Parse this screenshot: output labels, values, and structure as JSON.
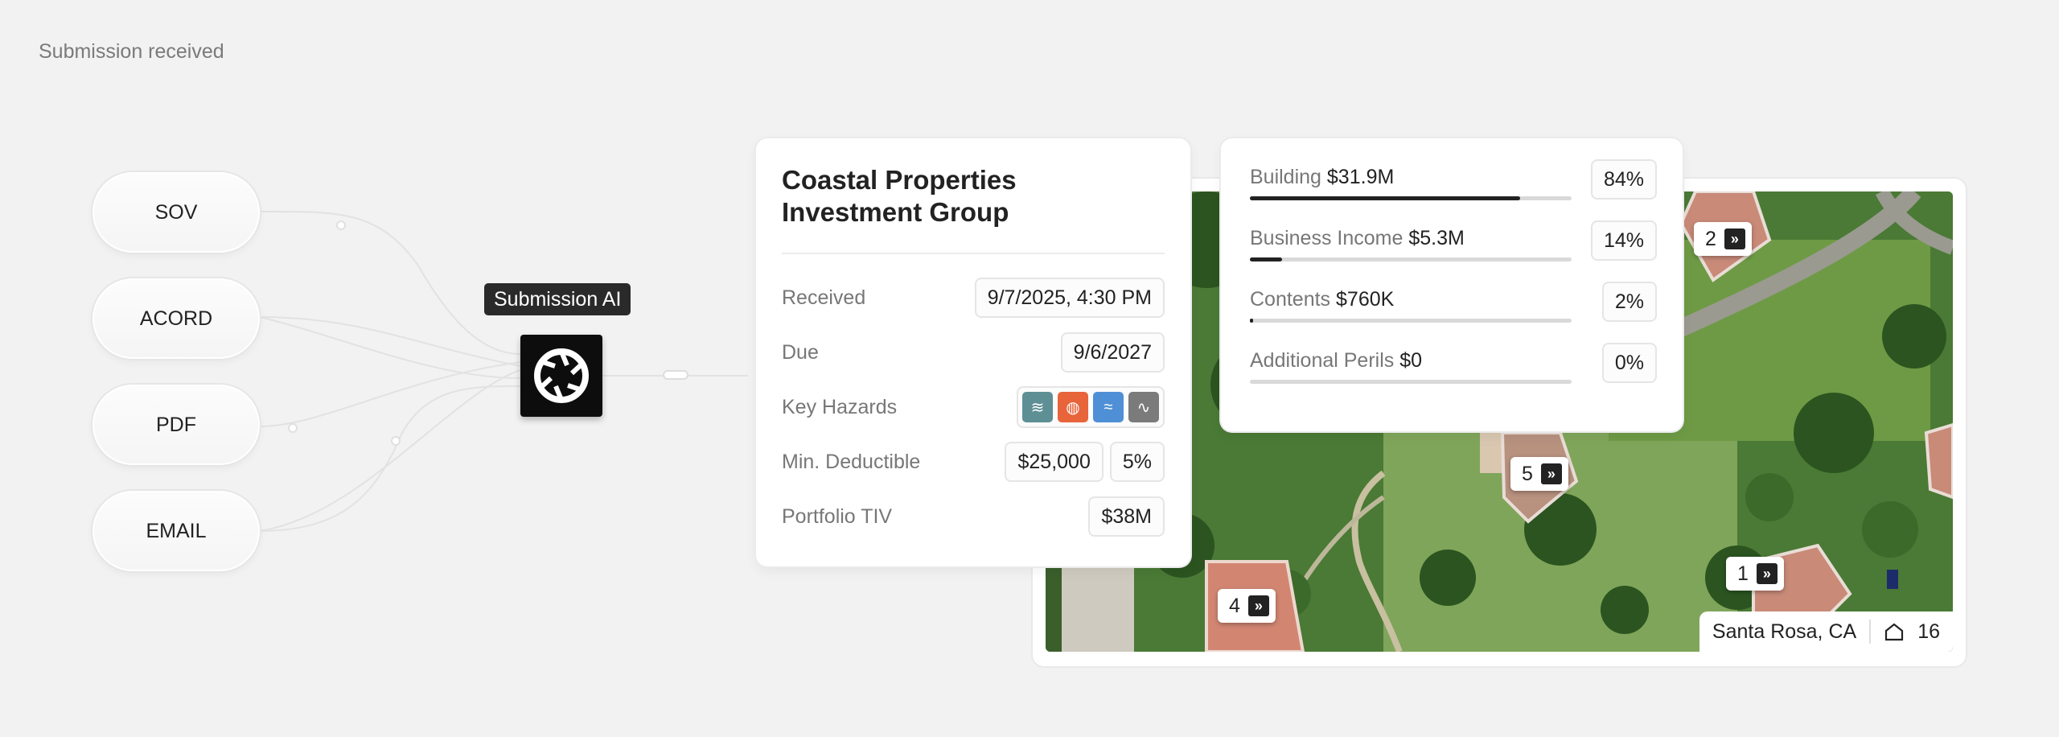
{
  "header": {
    "status": "Submission received"
  },
  "sources": [
    {
      "label": "SOV"
    },
    {
      "label": "ACORD"
    },
    {
      "label": "PDF"
    },
    {
      "label": "EMAIL"
    }
  ],
  "ai": {
    "label": "Submission AI",
    "icon": "aperture-logo-icon"
  },
  "submission": {
    "title": "Coastal Properties Investment Group",
    "received_label": "Received",
    "received_value": "9/7/2025, 4:30 PM",
    "due_label": "Due",
    "due_value": "9/6/2027",
    "hazards_label": "Key Hazards",
    "hazards": [
      {
        "name": "flood-icon",
        "color": "#5e8f95"
      },
      {
        "name": "fire-icon",
        "color": "#e8643b"
      },
      {
        "name": "wind-icon",
        "color": "#4f8fd6"
      },
      {
        "name": "earthquake-icon",
        "color": "#7b7b7b"
      }
    ],
    "deductible_label": "Min. Deductible",
    "deductible_amount": "$25,000",
    "deductible_pct": "5%",
    "tiv_label": "Portfolio TIV",
    "tiv_value": "$38M"
  },
  "tiv_breakdown": [
    {
      "label": "Building",
      "amount": "$31.9M",
      "pct_text": "84%",
      "share": 0.84
    },
    {
      "label": "Business Income",
      "amount": "$5.3M",
      "pct_text": "14%",
      "share": 0.1
    },
    {
      "label": "Contents",
      "amount": "$760K",
      "pct_text": "2%",
      "share": 0.01
    },
    {
      "label": "Additional Perils",
      "amount": "$0",
      "pct_text": "0%",
      "share": 0
    }
  ],
  "map": {
    "location": "Santa Rosa, CA",
    "property_count": "16",
    "pins": [
      "2",
      "5",
      "4",
      "1"
    ]
  }
}
